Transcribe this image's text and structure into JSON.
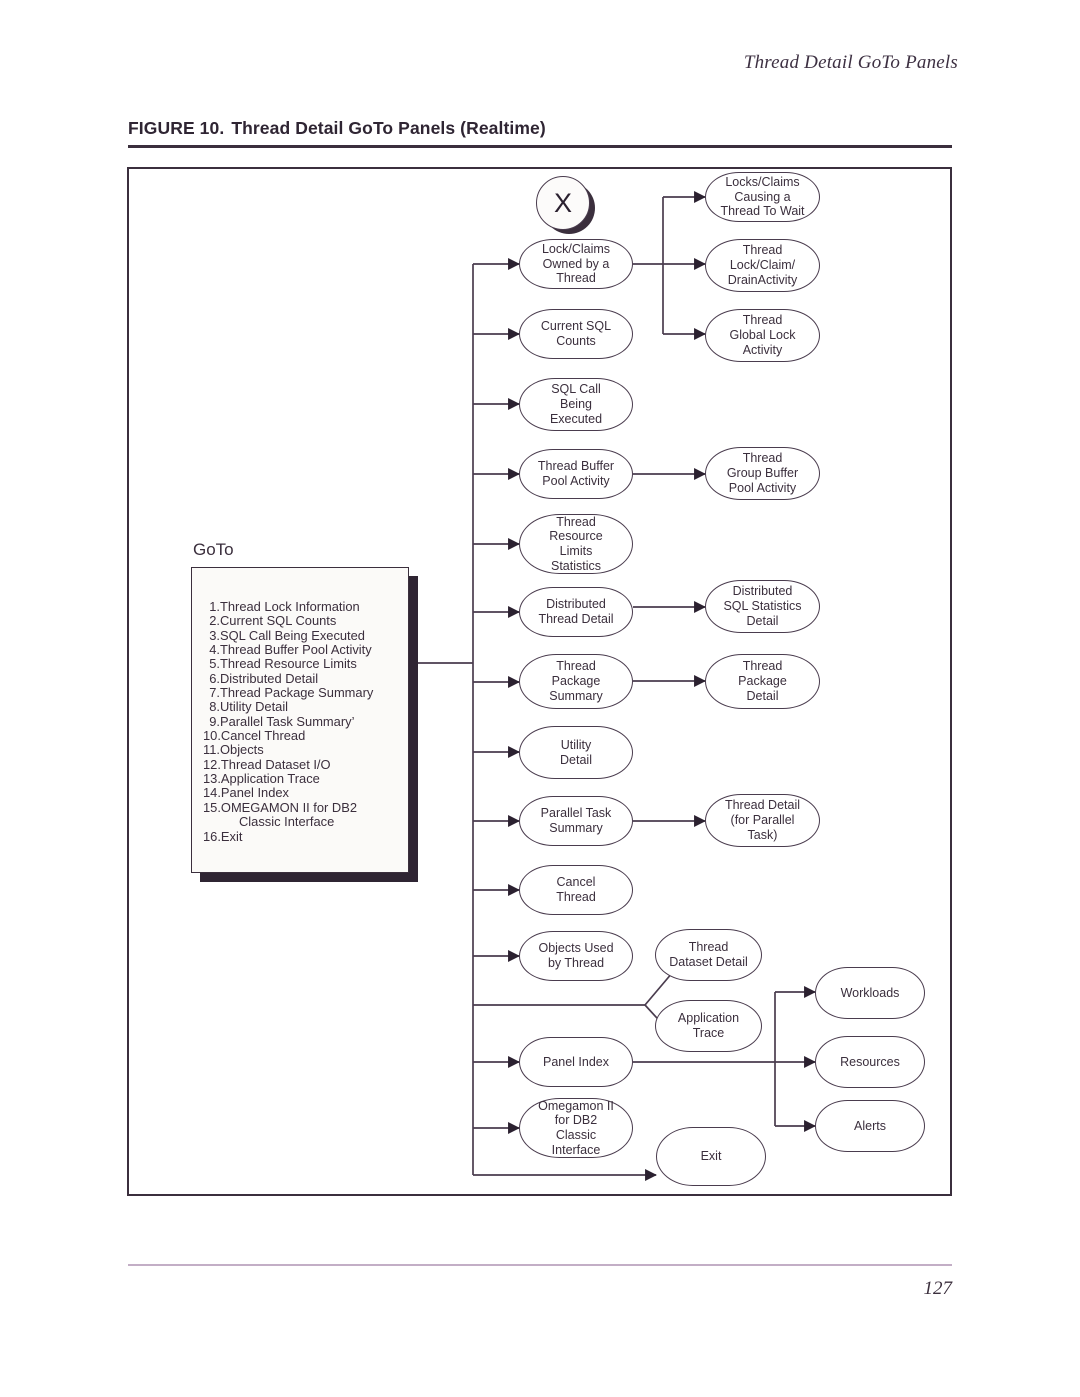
{
  "page": {
    "running_head": "Thread Detail GoTo Panels",
    "page_number": "127"
  },
  "figure": {
    "label": "FIGURE 10.",
    "title": "Thread Detail GoTo Panels (Realtime)"
  },
  "goto_panel": {
    "heading": "GoTo",
    "items": [
      {
        "num": "1.",
        "label": "Thread Lock Information"
      },
      {
        "num": "2.",
        "label": "Current SQL Counts"
      },
      {
        "num": "3.",
        "label": "SQL Call Being Executed"
      },
      {
        "num": "4.",
        "label": "Thread Buffer Pool Activity"
      },
      {
        "num": "5.",
        "label": "Thread Resource Limits"
      },
      {
        "num": "6.",
        "label": "Distributed Detail"
      },
      {
        "num": "7.",
        "label": "Thread Package Summary"
      },
      {
        "num": "8.",
        "label": "Utility Detail"
      },
      {
        "num": "9.",
        "label": "Parallel Task Summary’"
      },
      {
        "num": "10.",
        "label": "Cancel Thread"
      },
      {
        "num": "11.",
        "label": "Objects"
      },
      {
        "num": "12.",
        "label": "Thread Dataset I/O"
      },
      {
        "num": "13.",
        "label": "Application Trace"
      },
      {
        "num": "14.",
        "label": "Panel Index"
      },
      {
        "num": "15.",
        "label": "OMEGAMON II for DB2"
      },
      {
        "num": "",
        "label": "Classic Interface",
        "continuation": true
      },
      {
        "num": "16.",
        "label": "Exit"
      }
    ]
  },
  "badge": {
    "glyph": "X",
    "name": "x-close-badge"
  },
  "nodes": {
    "lock_claims_owned": "Lock/Claims\nOwned by a\nThread",
    "current_sql_counts": "Current SQL\nCounts",
    "sql_call_executed": "SQL Call\nBeing\nExecuted",
    "thread_buffer_pool": "Thread Buffer\nPool Activity",
    "thread_resource_limits": "Thread\nResource\nLimits\nStatistics",
    "distributed_thread": "Distributed\nThread Detail",
    "thread_package_summary": "Thread\nPackage\nSummary",
    "utility_detail": "Utility\nDetail",
    "parallel_task_summary": "Parallel Task\nSummary",
    "cancel_thread": "Cancel\nThread",
    "objects_used": "Objects Used\nby Thread",
    "panel_index": "Panel Index",
    "omegamon_classic": "Omegamon II\nfor DB2\nClassic\nInterface",
    "locks_claims_wait": "Locks/Claims\nCausing a\nThread To Wait",
    "thread_lock_drain": "Thread\nLock/Claim/\nDrainActivity",
    "thread_global_lock": "Thread\nGlobal Lock\nActivity",
    "thread_group_buffer": "Thread\nGroup Buffer\nPool Activity",
    "distributed_sql_stats": "Distributed\nSQL Statistics\nDetail",
    "thread_package_detail": "Thread\nPackage\nDetail",
    "thread_detail_parallel": "Thread Detail\n(for Parallel\nTask)",
    "thread_dataset_detail": "Thread\nDataset Detail",
    "application_trace": "Application\nTrace",
    "exit": "Exit",
    "workloads": "Workloads",
    "resources": "Resources",
    "alerts": "Alerts"
  },
  "colors": {
    "ink": "#3b2f3d",
    "node_border": "#4a3c4e",
    "shadow": "#2f2533",
    "rule": "#c3aec6",
    "panel_bg": "#fbfaf8"
  }
}
